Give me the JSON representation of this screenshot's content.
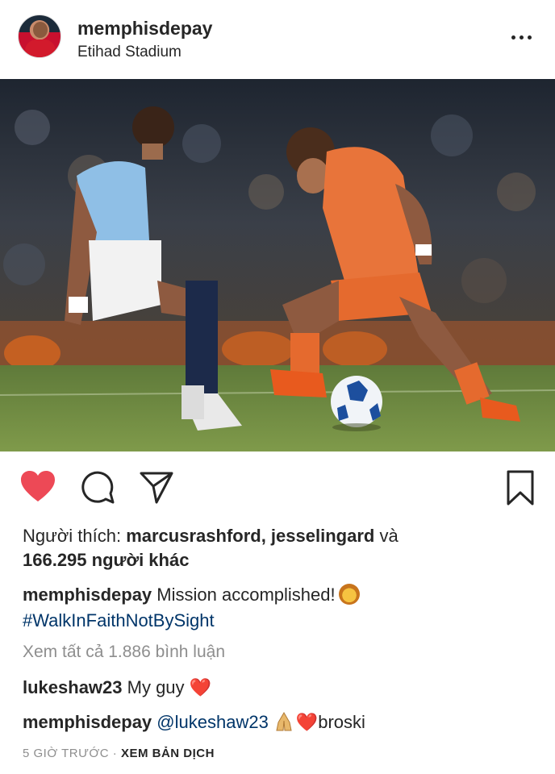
{
  "post": {
    "username": "memphisdepay",
    "location": "Etihad Stadium"
  },
  "likes": {
    "prefix": "Người thích: ",
    "users": "marcusrashford, jesselingard",
    "and": " và",
    "count": "166.295 người khác"
  },
  "caption": {
    "username": "memphisdepay",
    "text": " Mission accomplished!",
    "emoji": "lion-face-emoji",
    "hashtag": "#WalkInFaithNotBySight"
  },
  "comments": {
    "view_all": "Xem tất cả 1.886 bình luận",
    "items": [
      {
        "username": "lukeshaw23",
        "text": " My guy ",
        "emoji": "❤️"
      },
      {
        "username": "memphisdepay",
        "mention": "@lukeshaw23",
        "emoji1": "folded-hands-emoji",
        "emoji2": "❤️",
        "text": "broski"
      }
    ]
  },
  "footer": {
    "time": "5 GIỜ TRƯỚC",
    "separator": " · ",
    "translate": "XEM BẢN DỊCH"
  },
  "icons": {
    "like": "heart-icon",
    "comment": "comment-icon",
    "share": "direct-share-icon",
    "save": "bookmark-icon",
    "more": "more-options-icon"
  },
  "colors": {
    "heart_filled": "#ed4956",
    "hashtag_link": "#003569",
    "muted": "#8e8e8e",
    "text": "#262626"
  }
}
